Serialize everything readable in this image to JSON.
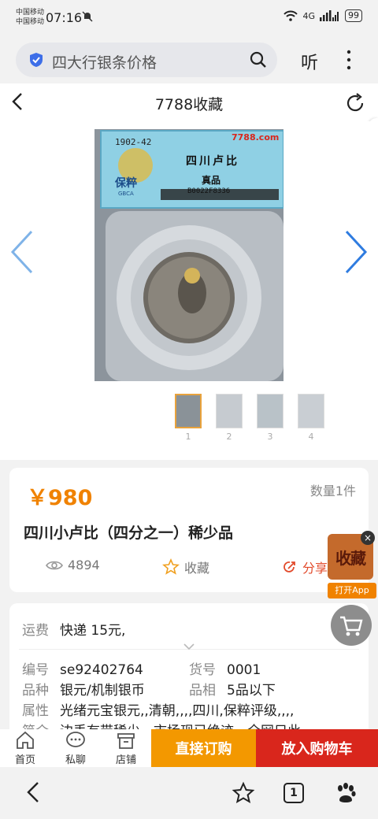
{
  "status": {
    "carrier1": "中国移动",
    "carrier2": "中国移动",
    "time": "07:16",
    "network1": "4G",
    "battery": "99"
  },
  "browser": {
    "search_text": "四大行银条价格",
    "listen_label": "听"
  },
  "header": {
    "title": "7788收藏"
  },
  "gallery": {
    "label_year": "1902-42",
    "label_title": "四川卢比",
    "label_grade": "真品",
    "label_code": "B0022F8336",
    "label_brand": "保粹",
    "label_brand_en": "GBCA",
    "watermark": "7788.com",
    "thumbs": [
      "1",
      "2",
      "3",
      "4"
    ]
  },
  "product": {
    "price": "￥980",
    "quantity": "数量1件",
    "title": "四川小卢比（四分之一）稀少品",
    "views": "4894",
    "collect_label": "收藏",
    "share_label": "分享"
  },
  "float_app": {
    "logo_text": "收藏",
    "open_label": "打开App"
  },
  "details": {
    "shipping_key": "运费",
    "shipping_value": "快递 15元,",
    "id_key": "编号",
    "id_value": "se92402764",
    "item_key": "货号",
    "item_value": "0001",
    "kind_key": "品种",
    "kind_value": "银元/机制银币",
    "grade_key": "品相",
    "grade_value": "5品以下",
    "attr_key": "属性",
    "attr_value": "光绪元宝银元,,清朝,,,,四川,保粹评级,,,,",
    "intro_key": "简介",
    "intro_value": "边丢有带稀少，市场现已绝迹，全网只此"
  },
  "actions": {
    "home": "首页",
    "chat": "私聊",
    "shop": "店铺",
    "order": "直接订购",
    "cart": "放入购物车"
  },
  "browserbar": {
    "tab_count": "1"
  },
  "colors": {
    "price": "#f08200",
    "order_button": "#f39800",
    "cart_button": "#d9261c",
    "share": "#e24a2b"
  }
}
